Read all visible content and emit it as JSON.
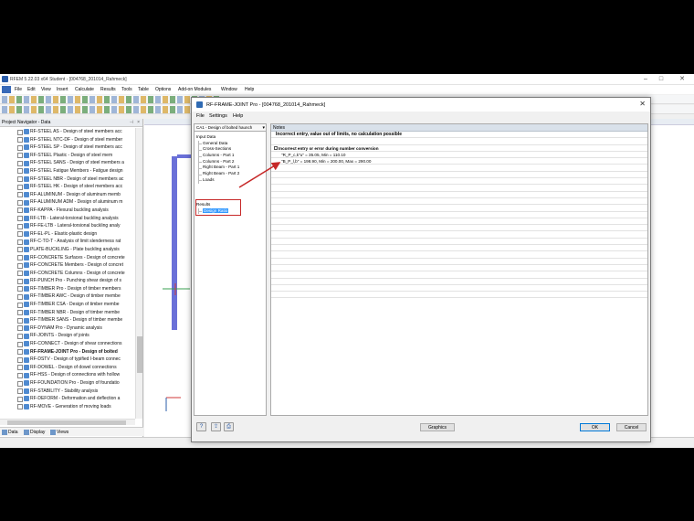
{
  "app": {
    "title": "RFEM 5.22.03 x64 Student - [004768_201014_Rahmeck]",
    "menu": [
      "File",
      "Edit",
      "View",
      "Insert",
      "Calculate",
      "Results",
      "Tools",
      "Table",
      "Options",
      "Add-on Modules",
      "Window",
      "Help"
    ]
  },
  "navigator": {
    "title": "Project Navigator - Data",
    "items": [
      "RF-STEEL AS - Design of steel members acc",
      "RF-STEEL NTC-DF - Design of steel member",
      "RF-STEEL SP - Design of steel members acc",
      "RF-STEEL Plastic - Design of steel mem",
      "RF-STEEL SANS - Design of steel members a",
      "RF-STEEL Fatigue Members - Fatigue design",
      "RF-STEEL NBR - Design of steel members ac",
      "RF-STEEL HK - Design of steel members acc",
      "RF-ALUMINUM - Design of aluminum memb",
      "RF-ALUMINUM ADM - Design of aluminum m",
      "RF-KAPPA - Flexural buckling analysis",
      "RF-LTB - Lateral-torsional buckling analysis",
      "RF-FE-LTB - Lateral-torsional buckling analy",
      "RF-EL-PL - Elastic-plastic design",
      "RF-C-TO-T - Analysis of limit slenderness rat",
      "PLATE-BUCKLING - Plate buckling analysis",
      "RF-CONCRETE Surfaces - Design of concrete",
      "RF-CONCRETE Members - Design of concret",
      "RF-CONCRETE Columns - Design of concrete",
      "RF-PUNCH Pro - Punching shear design of s",
      "RF-TIMBER Pro - Design of timber members",
      "RF-TIMBER AWC - Design of timber membe",
      "RF-TIMBER CSA - Design of timber membe",
      "RF-TIMBER NBR - Design of timber membe",
      "RF-TIMBER SANS - Design of timber membe",
      "RF-DYNAM Pro - Dynamic analysis",
      "RF-JOINTS - Design of joints",
      "RF-CONNECT - Design of shear connections",
      "RF-FRAME-JOINT Pro - Design of bolted",
      "RF-DSTV - Design of typified I-beam connec",
      "RF-DOWEL - Design of dowel connections",
      "RF-HSS - Design of connections with hollow",
      "RF-FOUNDATION Pro - Design of foundatio",
      "RF-STABILITY - Stability analysis",
      "RF-DEFORM - Deformation and deflection a",
      "RF-MOVE - Generation of moving loads"
    ],
    "bold_index": 28,
    "tabs": [
      "Data",
      "Display",
      "Views"
    ]
  },
  "dialog": {
    "title": "RF-FRAME-JOINT Pro - [004768_201014_Rahmeck]",
    "menu": [
      "File",
      "Settings",
      "Help"
    ],
    "case_select": "CA1 - Design of bolted haunch",
    "tree": {
      "input_label": "Input Data",
      "input_items": [
        "General Data",
        "Cross-Sections",
        "Columns - Part 1",
        "Columns - Part 2",
        "Right Beam - Part 1",
        "Right Beam - Part 2",
        "Loads"
      ],
      "results_label": "Results",
      "results_items": [
        "Design Ratio"
      ]
    },
    "notes": {
      "header": "Notes",
      "title_row": "Incorrect entry, value out of limits, no calculation possible",
      "group": "Incorrect entry or error during number conversion",
      "lines": [
        "\"R_P_c,k\"u\" = 35.05, Min = 110.10",
        "\"B_P_l,b\" = 198.90, Min = 200.00, Max = 290.00"
      ]
    },
    "buttons": {
      "graphics": "Graphics",
      "ok": "OK",
      "cancel": "Cancel"
    }
  },
  "colors": {
    "accent": "#2a5ca8",
    "highlight": "#c62828",
    "selection": "#3399ff",
    "member": "#6a70d8"
  }
}
